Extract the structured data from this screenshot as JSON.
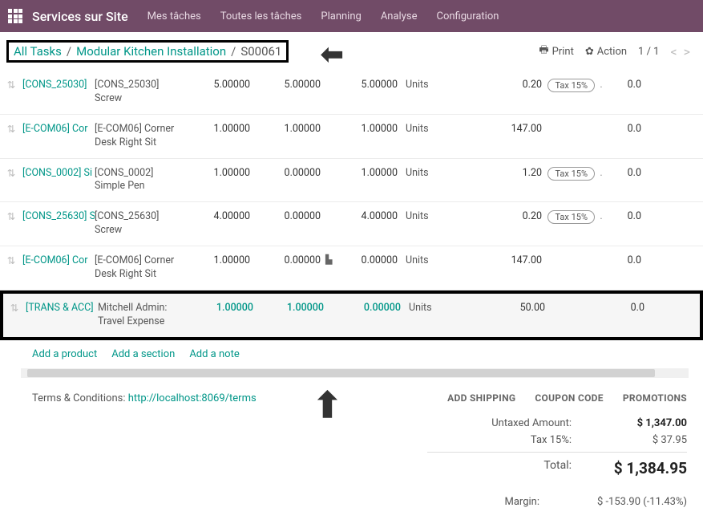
{
  "topbar": {
    "app_title": "Services sur Site",
    "menu": [
      "Mes tâches",
      "Toutes les tâches",
      "Planning",
      "Analyse",
      "Configuration"
    ]
  },
  "breadcrumb": {
    "root": "All Tasks",
    "parent": "Modular Kitchen Installation",
    "current": "S00061"
  },
  "header_actions": {
    "print": "Print",
    "action": "Action",
    "pager": "1 / 1"
  },
  "rows": [
    {
      "product": "[CONS_25030]",
      "desc": "[CONS_25030] Screw",
      "ordered": "5.00000",
      "delivered": "5.00000",
      "graph": false,
      "invoiced": "5.00000",
      "uom": "Units",
      "price": "0.20",
      "tax": "Tax 15%",
      "dot": ".",
      "subtotal": "0.0",
      "teal": false
    },
    {
      "product": "[E-COM06] Cor",
      "desc": "[E-COM06] Corner Desk Right Sit",
      "ordered": "1.00000",
      "delivered": "1.00000",
      "graph": false,
      "invoiced": "1.00000",
      "uom": "Units",
      "price": "147.00",
      "tax": "",
      "dot": "",
      "subtotal": "0.0",
      "teal": false
    },
    {
      "product": "[CONS_0002] Si",
      "desc": "[CONS_0002] Simple Pen",
      "ordered": "1.00000",
      "delivered": "0.00000",
      "graph": false,
      "invoiced": "1.00000",
      "uom": "Units",
      "price": "1.20",
      "tax": "Tax 15%",
      "dot": ".",
      "subtotal": "0.0",
      "teal": false
    },
    {
      "product": "[CONS_25630] S",
      "desc": "[CONS_25630] Screw",
      "ordered": "4.00000",
      "delivered": "0.00000",
      "graph": false,
      "invoiced": "4.00000",
      "uom": "Units",
      "price": "0.20",
      "tax": "Tax 15%",
      "dot": ".",
      "subtotal": "0.0",
      "teal": false
    },
    {
      "product": "[E-COM06] Cor",
      "desc": "[E-COM06] Corner Desk Right Sit",
      "ordered": "1.00000",
      "delivered": "0.00000",
      "graph": true,
      "invoiced": "0.00000",
      "uom": "Units",
      "price": "147.00",
      "tax": "",
      "dot": "",
      "subtotal": "0.0",
      "teal": false
    },
    {
      "product": "[TRANS & ACC]",
      "desc": "Mitchell Admin: Travel Expense",
      "ordered": "1.00000",
      "delivered": "1.00000",
      "graph": false,
      "invoiced": "0.00000",
      "uom": "Units",
      "price": "50.00",
      "tax": "",
      "dot": "",
      "subtotal": "0.0",
      "teal": true
    }
  ],
  "addline": {
    "product": "Add a product",
    "section": "Add a section",
    "note": "Add a note"
  },
  "terms": {
    "label": "Terms & Conditions: ",
    "url_text": "http://localhost:8069/terms"
  },
  "shipping_actions": {
    "shipping": "ADD SHIPPING",
    "coupon": "COUPON CODE",
    "promo": "PROMOTIONS"
  },
  "totals": {
    "untaxed_label": "Untaxed Amount:",
    "untaxed_val": "$ 1,347.00",
    "tax_label": "Tax 15%:",
    "tax_val": "$ 37.95",
    "total_label": "Total:",
    "total_val": "$ 1,384.95",
    "margin_label": "Margin:",
    "margin_val": "$ -153.90 (-11.43%)"
  }
}
